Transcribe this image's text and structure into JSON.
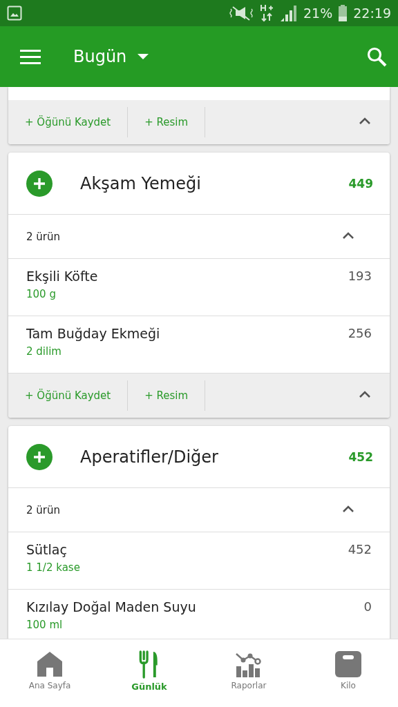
{
  "status_bar": {
    "battery": "21%",
    "time": "22:19"
  },
  "app_bar": {
    "title": "Bugün"
  },
  "previous_meal": {
    "actions": [
      "+ Öğünü Kaydet",
      "+ Resim"
    ],
    "expanded": true
  },
  "meals": [
    {
      "name": "Akşam Yemeği",
      "calories": "449",
      "item_count": "2 ürün",
      "expanded": true,
      "actions": [
        "+ Öğünü Kaydet",
        "+ Resim"
      ],
      "items": [
        {
          "name": "Ekşili Köfte",
          "amount": "100 g",
          "calories": "193"
        },
        {
          "name": "Tam Buğday Ekmeği",
          "amount": "2 dilim",
          "calories": "256"
        }
      ]
    },
    {
      "name": "Aperatifler/Diğer",
      "calories": "452",
      "item_count": "2 ürün",
      "expanded": true,
      "items": [
        {
          "name": "Sütlaç",
          "amount": "1 1/2 kase",
          "calories": "452"
        },
        {
          "name": "Kızılay Doğal Maden Suyu",
          "amount": "100 ml",
          "calories": "0"
        }
      ]
    }
  ],
  "bottom_nav": [
    {
      "kind": "home",
      "label": "Ana Sayfa",
      "selected": false
    },
    {
      "kind": "diary",
      "label": "Günlük",
      "selected": true
    },
    {
      "kind": "reports",
      "label": "Raporlar",
      "selected": false
    },
    {
      "kind": "weight",
      "label": "Kilo",
      "selected": false
    }
  ]
}
